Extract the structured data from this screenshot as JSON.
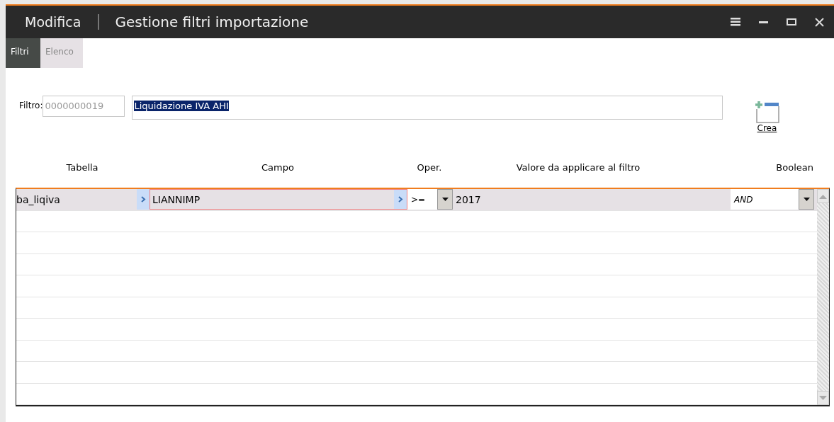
{
  "window": {
    "mode": "Modifica",
    "title": "Gestione filtri importazione"
  },
  "tabs": [
    {
      "label": "Filtri",
      "selected": true
    },
    {
      "label": "Elenco",
      "selected": false
    }
  ],
  "filter": {
    "label": "Filtro:",
    "code": "0000000019",
    "description": "Liquidazione IVA AHI",
    "description_selected": true
  },
  "create_button": {
    "label": "Crea"
  },
  "table": {
    "columns": [
      "Tabella",
      "Campo",
      "Oper.",
      "Valore da applicare al filtro",
      "Boolean"
    ],
    "rows": [
      {
        "tabella": "ba_liqiva",
        "campo": "LIANNIMP",
        "oper": ">=",
        "valore": "2017",
        "boolean": "AND",
        "selected": true
      }
    ]
  }
}
